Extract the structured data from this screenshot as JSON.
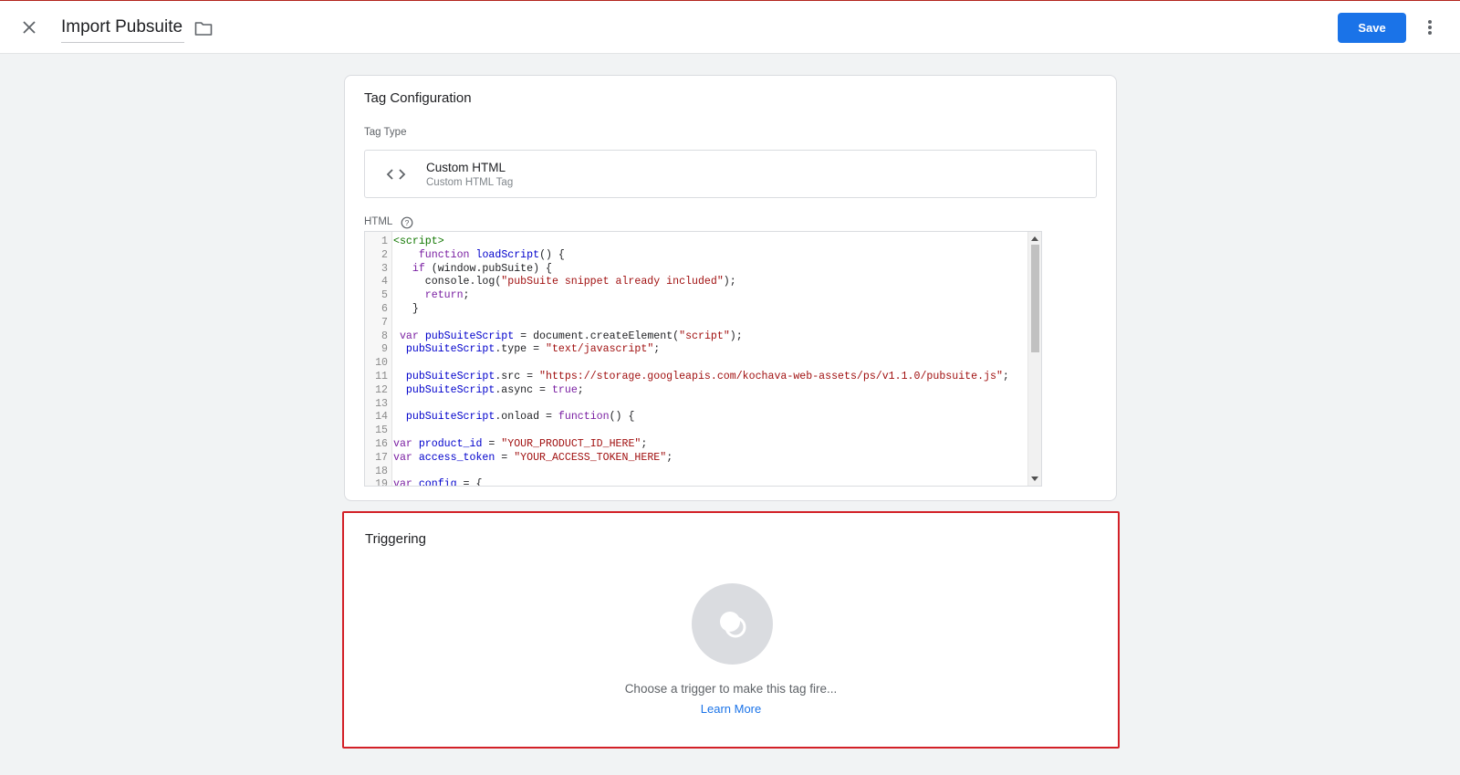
{
  "header": {
    "title": "Import Pubsuite",
    "save_label": "Save"
  },
  "tag_config": {
    "title": "Tag Configuration",
    "tag_type_label": "Tag Type",
    "tag_type_name": "Custom HTML",
    "tag_type_sub": "Custom HTML Tag",
    "html_label": "HTML",
    "code_lines": [
      {
        "n": "1",
        "parts": [
          {
            "c": "#117700",
            "t": "<script>"
          }
        ]
      },
      {
        "n": "2",
        "parts": [
          {
            "c": "#202124",
            "t": "    "
          },
          {
            "c": "#7a1fa2",
            "t": "function"
          },
          {
            "c": "#202124",
            "t": " "
          },
          {
            "c": "#0000cc",
            "t": "loadScript"
          },
          {
            "c": "#202124",
            "t": "() {"
          }
        ]
      },
      {
        "n": "3",
        "parts": [
          {
            "c": "#202124",
            "t": "   "
          },
          {
            "c": "#7a1fa2",
            "t": "if"
          },
          {
            "c": "#202124",
            "t": " (window.pubSuite) {"
          }
        ]
      },
      {
        "n": "4",
        "parts": [
          {
            "c": "#202124",
            "t": "     console.log("
          },
          {
            "c": "#a11111",
            "t": "\"pubSuite snippet already included\""
          },
          {
            "c": "#202124",
            "t": ");"
          }
        ]
      },
      {
        "n": "5",
        "parts": [
          {
            "c": "#202124",
            "t": "     "
          },
          {
            "c": "#7a1fa2",
            "t": "return"
          },
          {
            "c": "#202124",
            "t": ";"
          }
        ]
      },
      {
        "n": "6",
        "parts": [
          {
            "c": "#202124",
            "t": "   }"
          }
        ]
      },
      {
        "n": "7",
        "parts": []
      },
      {
        "n": "8",
        "parts": [
          {
            "c": "#202124",
            "t": " "
          },
          {
            "c": "#7a1fa2",
            "t": "var"
          },
          {
            "c": "#202124",
            "t": " "
          },
          {
            "c": "#0000cc",
            "t": "pubSuiteScript"
          },
          {
            "c": "#202124",
            "t": " = document.createElement("
          },
          {
            "c": "#a11111",
            "t": "\"script\""
          },
          {
            "c": "#202124",
            "t": ");"
          }
        ]
      },
      {
        "n": "9",
        "parts": [
          {
            "c": "#202124",
            "t": "  "
          },
          {
            "c": "#0000cc",
            "t": "pubSuiteScript"
          },
          {
            "c": "#202124",
            "t": ".type = "
          },
          {
            "c": "#a11111",
            "t": "\"text/javascript\""
          },
          {
            "c": "#202124",
            "t": ";"
          }
        ]
      },
      {
        "n": "10",
        "parts": []
      },
      {
        "n": "11",
        "parts": [
          {
            "c": "#202124",
            "t": "  "
          },
          {
            "c": "#0000cc",
            "t": "pubSuiteScript"
          },
          {
            "c": "#202124",
            "t": ".src = "
          },
          {
            "c": "#a11111",
            "t": "\"https://storage.googleapis.com/kochava-web-assets/ps/v1.1.0/pubsuite.js\""
          },
          {
            "c": "#202124",
            "t": ";"
          }
        ]
      },
      {
        "n": "12",
        "parts": [
          {
            "c": "#202124",
            "t": "  "
          },
          {
            "c": "#0000cc",
            "t": "pubSuiteScript"
          },
          {
            "c": "#202124",
            "t": ".async = "
          },
          {
            "c": "#7a1fa2",
            "t": "true"
          },
          {
            "c": "#202124",
            "t": ";"
          }
        ]
      },
      {
        "n": "13",
        "parts": []
      },
      {
        "n": "14",
        "parts": [
          {
            "c": "#202124",
            "t": "  "
          },
          {
            "c": "#0000cc",
            "t": "pubSuiteScript"
          },
          {
            "c": "#202124",
            "t": ".onload = "
          },
          {
            "c": "#7a1fa2",
            "t": "function"
          },
          {
            "c": "#202124",
            "t": "() {"
          }
        ]
      },
      {
        "n": "15",
        "parts": []
      },
      {
        "n": "16",
        "parts": [
          {
            "c": "#7a1fa2",
            "t": "var"
          },
          {
            "c": "#202124",
            "t": " "
          },
          {
            "c": "#0000cc",
            "t": "product_id"
          },
          {
            "c": "#202124",
            "t": " = "
          },
          {
            "c": "#a11111",
            "t": "\"YOUR_PRODUCT_ID_HERE\""
          },
          {
            "c": "#202124",
            "t": ";"
          }
        ]
      },
      {
        "n": "17",
        "parts": [
          {
            "c": "#7a1fa2",
            "t": "var"
          },
          {
            "c": "#202124",
            "t": " "
          },
          {
            "c": "#0000cc",
            "t": "access_token"
          },
          {
            "c": "#202124",
            "t": " = "
          },
          {
            "c": "#a11111",
            "t": "\"YOUR_ACCESS_TOKEN_HERE\""
          },
          {
            "c": "#202124",
            "t": ";"
          }
        ]
      },
      {
        "n": "18",
        "parts": []
      },
      {
        "n": "19",
        "parts": [
          {
            "c": "#7a1fa2",
            "t": "var"
          },
          {
            "c": "#202124",
            "t": " "
          },
          {
            "c": "#0000cc",
            "t": "config"
          },
          {
            "c": "#202124",
            "t": " = {"
          }
        ]
      }
    ]
  },
  "triggering": {
    "title": "Triggering",
    "message": "Choose a trigger to make this tag fire...",
    "learn_more": "Learn More"
  },
  "colors": {
    "accent": "#1a73e8",
    "highlight_border": "#d32027"
  }
}
